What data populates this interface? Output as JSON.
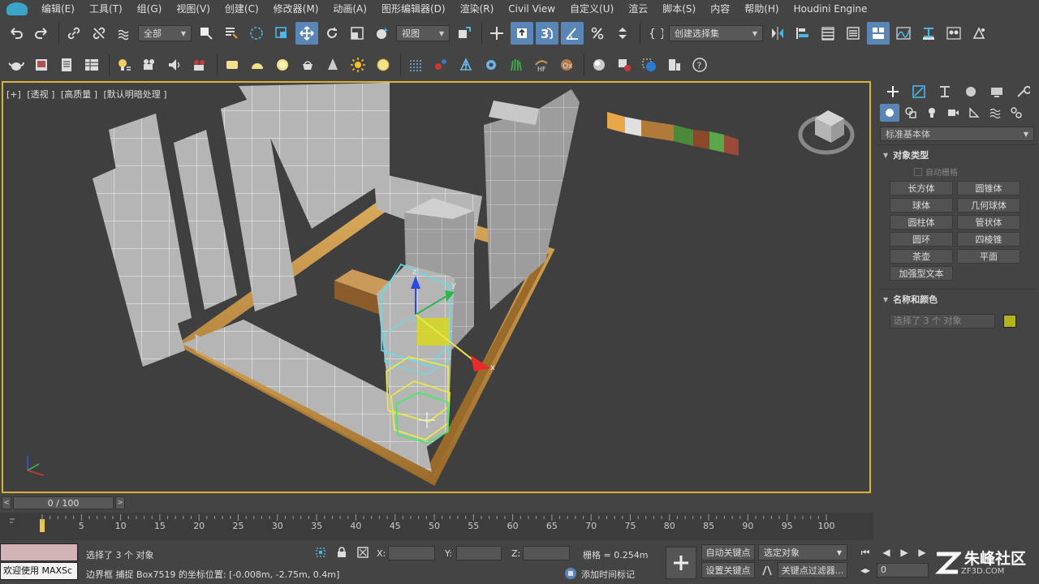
{
  "menu": {
    "items": [
      "编辑(E)",
      "工具(T)",
      "组(G)",
      "视图(V)",
      "创建(C)",
      "修改器(M)",
      "动画(A)",
      "图形编辑器(D)",
      "渲染(R)",
      "Civil View",
      "自定义(U)",
      "渲云",
      "脚本(S)",
      "内容",
      "帮助(H)",
      "Houdini Engine"
    ]
  },
  "toolbar": {
    "filter_value": "全部",
    "refcoord_value": "视图",
    "selection_set_value": "创建选择集"
  },
  "viewport": {
    "label_plus": "[+]",
    "label_view": "[透视 ]",
    "label_quality": "[高质量 ]",
    "label_lighting": "[默认明暗处理 ]",
    "axis_x": "x",
    "axis_y": "y",
    "axis_z": "z",
    "border_color": "#d9b23a"
  },
  "command_panel": {
    "category_dropdown": "标准基本体",
    "object_type_title": "对象类型",
    "autogrid_label": "自动栅格",
    "buttons": [
      "长方体",
      "圆锥体",
      "球体",
      "几何球体",
      "圆柱体",
      "管状体",
      "圆环",
      "四棱锥",
      "茶壶",
      "平面",
      "加强型文本"
    ],
    "name_color_title": "名称和颜色",
    "name_value": "选择了 3 个 对象",
    "object_color": "#b3b31a"
  },
  "time_slider": {
    "prev": "<",
    "next": ">",
    "frame_text": "0 / 100",
    "ticks": [
      5,
      10,
      15,
      20,
      25,
      30,
      35,
      40,
      45,
      50,
      55,
      60,
      65,
      70,
      75,
      80,
      85,
      90,
      95,
      100
    ]
  },
  "status": {
    "maxscript_text": "欢迎使用 MAXSc",
    "selection_text": "选择了 3 个 对象",
    "prompt_text": "边界框 捕捉 Box7519 的坐标位置:  [-0.008m, -2.75m, 0.4m]",
    "x_label": "X:",
    "y_label": "Y:",
    "z_label": "Z:",
    "grid_text": "栅格 = 0.254m",
    "add_time_tag": "添加时间标记",
    "auto_key": "自动关键点",
    "set_key": "设置关键点",
    "selected_object": "选定对象",
    "key_filters": "关键点过滤器...",
    "current_frame": "0"
  },
  "watermark": {
    "text": "朱峰社区",
    "sub": "ZF3D.COM"
  }
}
